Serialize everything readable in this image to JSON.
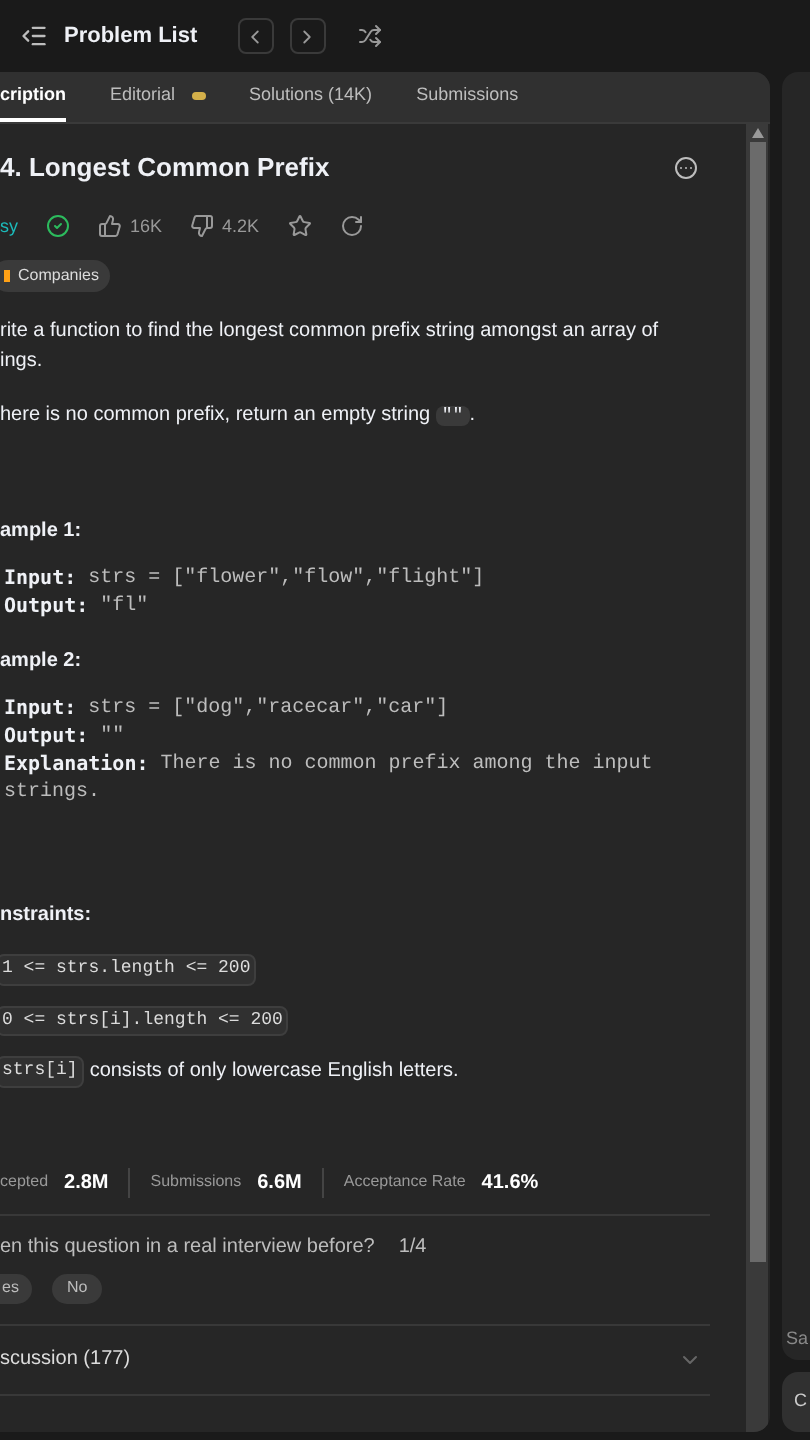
{
  "topbar": {
    "title": "Problem List"
  },
  "tabs": [
    {
      "label": "cription",
      "selected": true,
      "badge": false
    },
    {
      "label": "Editorial",
      "selected": false,
      "badge": true
    },
    {
      "label": "Solutions (14K)",
      "selected": false,
      "badge": false
    },
    {
      "label": "Submissions",
      "selected": false,
      "badge": false
    }
  ],
  "problem": {
    "title": "4. Longest Common Prefix",
    "difficulty": "sy",
    "solved": true,
    "likes": "16K",
    "dislikes": "4.2K",
    "companies": "Companies"
  },
  "description": [
    {
      "lines": [
        "rite a function to find the longest common prefix string amongst an array of",
        "ings."
      ]
    },
    {
      "lines": [
        "here is no common prefix, return an empty string "
      ],
      "code": "\"\"",
      "after": "."
    }
  ],
  "examples": [
    {
      "title": "ample 1:",
      "rows": [
        {
          "label": "Input:",
          "lines": [
            "strs = [\"flower\",\"flow\",\"flight\"]"
          ]
        },
        {
          "label": "Output:",
          "lines": [
            "\"fl\""
          ]
        }
      ]
    },
    {
      "title": "ample 2:",
      "rows": [
        {
          "label": "Input:",
          "lines": [
            "strs = [\"dog\",\"racecar\",\"car\"]"
          ]
        },
        {
          "label": "Output:",
          "lines": [
            "\"\""
          ]
        },
        {
          "label": "Explanation:",
          "lines": [
            "There is no common prefix among the input",
            "strings."
          ]
        }
      ]
    }
  ],
  "constraints_title": "nstraints:",
  "constraints": [
    {
      "code": "1 <= strs.length <= 200"
    },
    {
      "code": "0 <= strs[i].length <= 200"
    },
    {
      "code": "strs[i]",
      "text": "consists of only lowercase English letters."
    }
  ],
  "stats": [
    {
      "label": "cepted",
      "value": "2.8M"
    },
    {
      "label": "Submissions",
      "value": "6.6M"
    },
    {
      "label": "Acceptance Rate",
      "value": "41.6%"
    }
  ],
  "interview": {
    "question": "en this question in a real interview before?",
    "count": "1/4",
    "answers": [
      "es",
      "No"
    ]
  },
  "discussion": {
    "label": "scussion (177)",
    "expanded": false
  },
  "side": {
    "label": "Sa",
    "button": "C"
  }
}
